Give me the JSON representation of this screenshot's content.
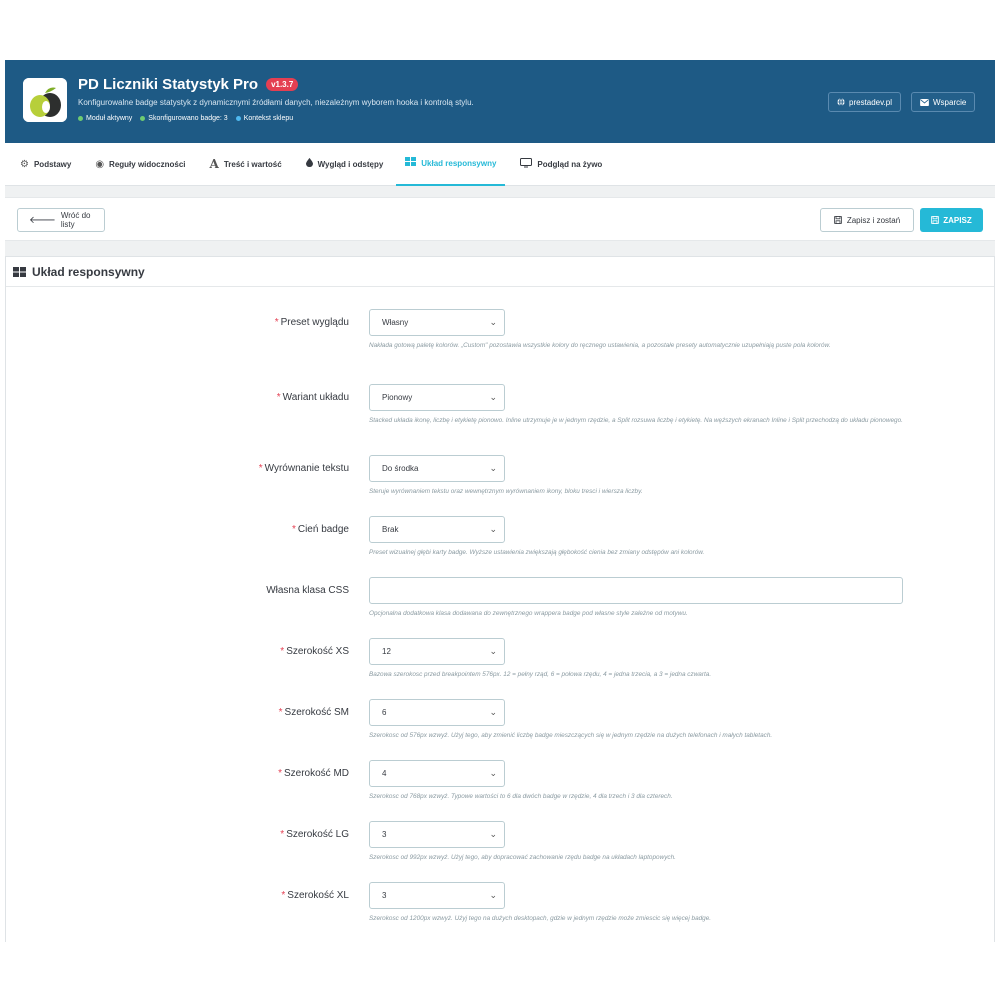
{
  "header": {
    "title": "PD Liczniki Statystyk Pro",
    "version": "v1.3.7",
    "subtitle": "Konfigurowalne badge statystyk z dynamicznymi źródłami danych, niezależnym wyborem hooka i kontrolą stylu.",
    "status": [
      "Moduł aktywny",
      "Skonfigurowano badge: 3",
      "Kontekst sklepu"
    ],
    "link_site": "prestadev.pl",
    "link_support": "Wsparcie"
  },
  "tabs": [
    {
      "label": "Podstawy",
      "icon": "cogs-icon"
    },
    {
      "label": "Reguły widoczności",
      "icon": "eye-icon"
    },
    {
      "label": "Treść i wartość",
      "icon": "font-icon"
    },
    {
      "label": "Wygląd i odstępy",
      "icon": "droplet-icon"
    },
    {
      "label": "Układ responsywny",
      "icon": "grid-icon",
      "active": true
    },
    {
      "label": "Podgląd na żywo",
      "icon": "monitor-icon"
    }
  ],
  "toolbar": {
    "back_label": "Wróć do listy",
    "save_stay_label": "Zapisz i zostań",
    "save_label": "ZAPISZ"
  },
  "panel": {
    "title": "Układ responsywny",
    "fields": [
      {
        "label": "Preset wyglądu",
        "required": true,
        "type": "select",
        "value": "Własny",
        "help": "Nakłada gotową paletę kolorów. „Custom\" pozostawia wszystkie kolory do ręcznego ustawienia, a pozostałe presety automatycznie uzupełniają puste pola kolorów."
      },
      {
        "label": "Wariant układu",
        "required": true,
        "type": "select",
        "value": "Pionowy",
        "help": "Stacked układa ikonę, liczbę i etykietę pionowo. Inline utrzymuje je w jednym rzędzie, a Split rozsuwa liczbę i etykietę. Na węższych ekranach Inline i Split przechodzą do układu pionowego."
      },
      {
        "label": "Wyrównanie tekstu",
        "required": true,
        "type": "select",
        "value": "Do środka",
        "help": "Steruje wyrównaniem tekstu oraz wewnętrznym wyrównaniem ikony, bloku tresci i wiersza liczby."
      },
      {
        "label": "Cień badge",
        "required": true,
        "type": "select",
        "value": "Brak",
        "help": "Preset wizualnej głębi karty badge. Wyższe ustawienia zwiększają głębokość cienia bez zmiany odstępów ani kolorów."
      },
      {
        "label": "Własna klasa CSS",
        "required": false,
        "type": "text",
        "value": "",
        "help": "Opcjonalna dodatkowa klasa dodawana do zewnętrznego wrappera badge pod własne style zależne od motywu."
      },
      {
        "label": "Szerokość XS",
        "required": true,
        "type": "select",
        "value": "12",
        "help": "Bazowa szerokosc przed breakpointem 576px. 12 = pełny rząd, 6 = połowa rzędu, 4 = jedna trzecia, a 3 = jedna czwarta."
      },
      {
        "label": "Szerokość SM",
        "required": true,
        "type": "select",
        "value": "6",
        "help": "Szerokosc od 576px wzwyż. Użyj tego, aby zmienić liczbę badge mieszczących się w jednym rzędzie na dużych telefonach i małych tabletach."
      },
      {
        "label": "Szerokość MD",
        "required": true,
        "type": "select",
        "value": "4",
        "help": "Szerokosc od 768px wzwyż. Typowe wartości to 6 dla dwóch badge w rzędzie, 4 dla trzech i 3 dla czterech."
      },
      {
        "label": "Szerokość LG",
        "required": true,
        "type": "select",
        "value": "3",
        "help": "Szerokosc od 992px wzwyż. Użyj tego, aby dopracować zachowanie rzędu badge na układach laptopowych."
      },
      {
        "label": "Szerokość XL",
        "required": true,
        "type": "select",
        "value": "3",
        "help": "Szerokosc od 1200px wzwyż. Użyj tego na dużych desktopach, gdzie w jednym rzędzie może zmiescic się więcej badge."
      }
    ]
  },
  "colors": {
    "header_bg": "#1e5a85",
    "accent": "#25b9d7",
    "required": "#e43f52",
    "version_badge": "#e43f52"
  }
}
